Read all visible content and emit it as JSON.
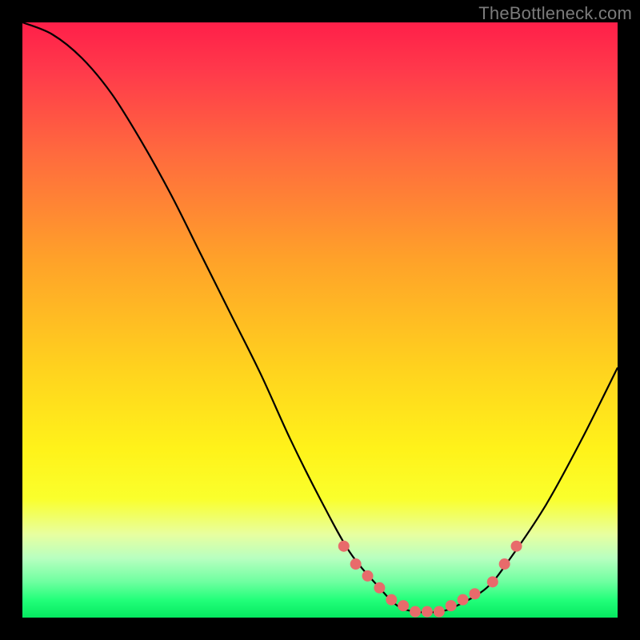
{
  "attribution": "TheBottleneck.com",
  "chart_data": {
    "type": "line",
    "title": "",
    "xlabel": "",
    "ylabel": "",
    "xlim": [
      0,
      100
    ],
    "ylim": [
      0,
      100
    ],
    "series": [
      {
        "name": "bottleneck-curve",
        "x": [
          0,
          5,
          10,
          15,
          20,
          25,
          30,
          35,
          40,
          45,
          50,
          55,
          60,
          63,
          66,
          70,
          73,
          78,
          82,
          88,
          94,
          100
        ],
        "values": [
          100,
          98,
          94,
          88,
          80,
          71,
          61,
          51,
          41,
          30,
          20,
          11,
          5,
          2,
          1,
          1,
          2,
          5,
          10,
          19,
          30,
          42
        ]
      }
    ],
    "markers": {
      "name": "highlight-points",
      "x": [
        54,
        56,
        58,
        60,
        62,
        64,
        66,
        68,
        70,
        72,
        74,
        76,
        79,
        81,
        83
      ],
      "values": [
        12,
        9,
        7,
        5,
        3,
        2,
        1,
        1,
        1,
        2,
        3,
        4,
        6,
        9,
        12
      ],
      "color": "#e86b6b",
      "radius": 7
    },
    "gradient_colors": {
      "top": "#ff1f49",
      "mid": "#ffd21e",
      "bottom": "#05e860"
    }
  }
}
